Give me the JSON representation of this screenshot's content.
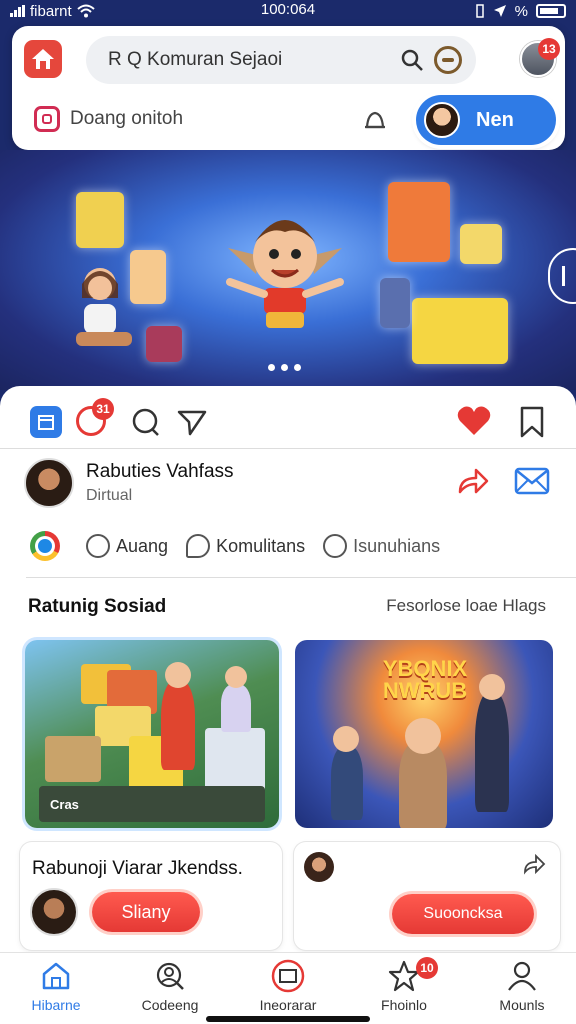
{
  "status_bar": {
    "carrier": "fibarnt",
    "time": "100:064",
    "extra": "%"
  },
  "header": {
    "search_placeholder": "R  Q  Komuran Sejaoi",
    "notification_badge": "13",
    "subtitle": "Doang onitoh",
    "new_button_label": "Nen"
  },
  "toolbar": {
    "badge": "31"
  },
  "post": {
    "name": "Rabuties Vahfass",
    "subtitle": "Dirtual"
  },
  "chips": [
    {
      "label": "Auang"
    },
    {
      "label": "Komulitans"
    },
    {
      "label": "Isunuhians"
    }
  ],
  "section": {
    "title": "Ratunig Sosiad",
    "link": "Fesorlose loae Hlags"
  },
  "thumbnails": {
    "left_caption": "Cras",
    "right_title_1": "YBQNIX",
    "right_title_2": "NWRUB"
  },
  "cards": {
    "left": {
      "title": "Rabunoji Viarar Jkendss.",
      "button": "Sliany"
    },
    "right": {
      "button": "Suooncksa"
    }
  },
  "nav": {
    "items": [
      {
        "label": "Hibarne",
        "icon": "home-icon"
      },
      {
        "label": "Codeeng",
        "icon": "search-person-icon"
      },
      {
        "label": "Ineorarar",
        "icon": "media-icon"
      },
      {
        "label": "Fhoinlo",
        "icon": "star-icon",
        "badge": "10"
      },
      {
        "label": "Mounls",
        "icon": "profile-icon"
      }
    ]
  },
  "colors": {
    "accent": "#2f7be6",
    "brand_red": "#e53935",
    "hero_bg": "#24307d"
  }
}
